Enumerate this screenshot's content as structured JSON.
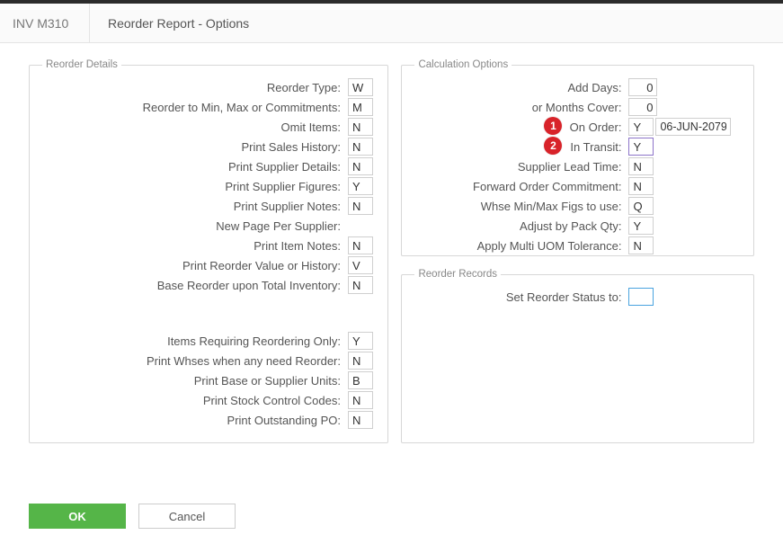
{
  "header": {
    "code": "INV M310",
    "title": "Reorder Report - Options"
  },
  "panels": {
    "reorder_details": "Reorder Details",
    "calc_options": "Calculation Options",
    "reorder_records": "Reorder Records"
  },
  "rd": {
    "reorder_type": {
      "label": "Reorder Type:",
      "value": "W"
    },
    "reorder_minmax": {
      "label": "Reorder to Min, Max or Commitments:",
      "value": "M"
    },
    "omit_items": {
      "label": "Omit Items:",
      "value": "N"
    },
    "print_sales_history": {
      "label": "Print Sales History:",
      "value": "N"
    },
    "print_supplier_details": {
      "label": "Print Supplier Details:",
      "value": "N"
    },
    "print_supplier_figures": {
      "label": "Print Supplier Figures:",
      "value": "Y"
    },
    "print_supplier_notes": {
      "label": "Print Supplier Notes:",
      "value": "N"
    },
    "new_page_per_supplier": {
      "label": "New Page Per Supplier:",
      "value": ""
    },
    "print_item_notes": {
      "label": "Print Item Notes:",
      "value": "N"
    },
    "print_reorder_value": {
      "label": "Print Reorder Value or History:",
      "value": "V"
    },
    "base_reorder_total_inv": {
      "label": "Base Reorder upon Total Inventory:",
      "value": "N"
    },
    "items_req_reorder": {
      "label": "Items Requiring Reordering Only:",
      "value": "Y"
    },
    "print_whses": {
      "label": "Print Whses when any need Reorder:",
      "value": "N"
    },
    "print_base_supplier_units": {
      "label": "Print Base or Supplier Units:",
      "value": "B"
    },
    "print_stock_control_codes": {
      "label": "Print Stock Control Codes:",
      "value": "N"
    },
    "print_outstanding_po": {
      "label": "Print Outstanding PO:",
      "value": "N"
    }
  },
  "co": {
    "add_days": {
      "label": "Add Days:",
      "value": "0"
    },
    "months_cover": {
      "label": "or Months Cover:",
      "value": "0"
    },
    "on_order": {
      "label": "On Order:",
      "value": "Y",
      "date": "06-JUN-2079"
    },
    "in_transit": {
      "label": "In Transit:",
      "value": "Y"
    },
    "supplier_lead_time": {
      "label": "Supplier Lead Time:",
      "value": "N"
    },
    "forward_order_commit": {
      "label": "Forward Order Commitment:",
      "value": "N"
    },
    "whse_minmax": {
      "label": "Whse Min/Max Figs to use:",
      "value": "Q"
    },
    "adjust_pack_qty": {
      "label": "Adjust by Pack Qty:",
      "value": "Y"
    },
    "apply_multi_uom": {
      "label": "Apply Multi UOM Tolerance:",
      "value": "N"
    }
  },
  "rr": {
    "set_reorder_status": {
      "label": "Set Reorder Status to:",
      "value": ""
    }
  },
  "badges": {
    "b1": "1",
    "b2": "2"
  },
  "actions": {
    "ok": "OK",
    "cancel": "Cancel"
  }
}
